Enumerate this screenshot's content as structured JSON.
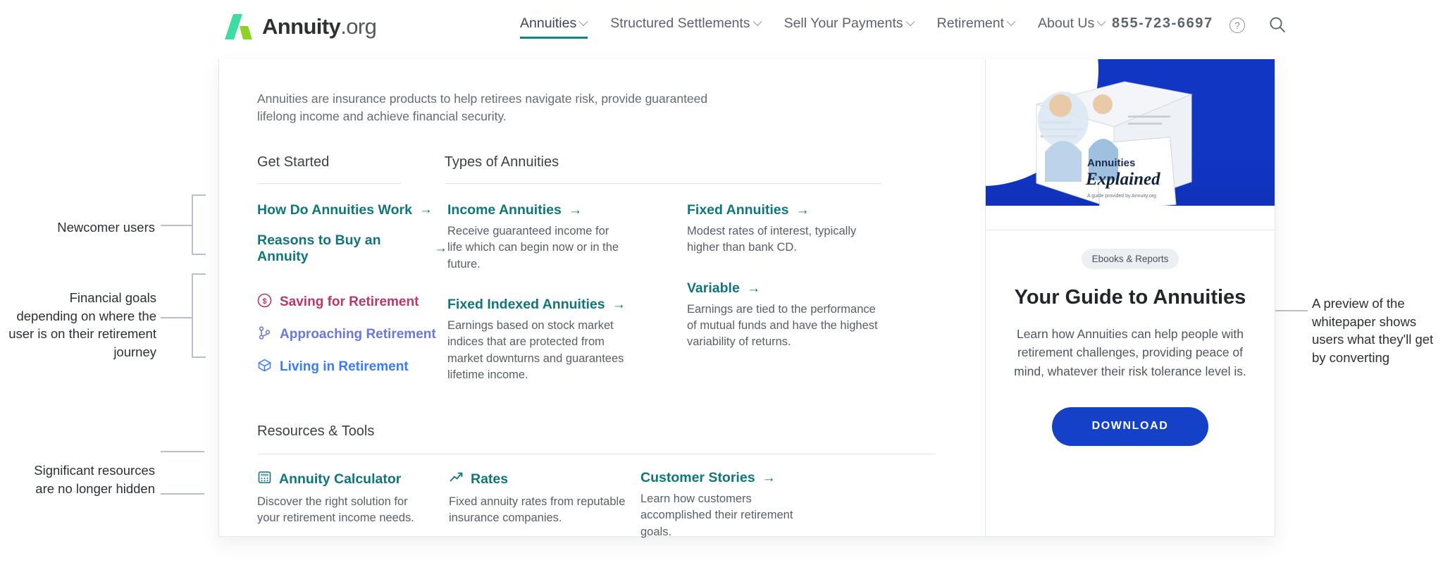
{
  "brand": {
    "name": "Annuity",
    "suffix": ".org"
  },
  "nav": {
    "items": [
      {
        "label": "Annuities",
        "caret": true,
        "active": true
      },
      {
        "label": "Structured Settlements",
        "caret": true,
        "active": false
      },
      {
        "label": "Sell Your Payments",
        "caret": true,
        "active": false
      },
      {
        "label": "Retirement",
        "caret": true,
        "active": false
      },
      {
        "label": "About Us",
        "caret": true,
        "active": false
      }
    ],
    "phone": "855-723-6697",
    "help_icon": "question-circle-icon",
    "search_icon": "search-icon"
  },
  "menu": {
    "intro": "Annuities are insurance products to help retirees navigate risk, provide guaranteed lifelong income and achieve financial security.",
    "headings": {
      "get_started": "Get Started",
      "types": "Types of Annuities",
      "resources": "Resources & Tools"
    },
    "get_started_links": [
      {
        "label": "How Do Annuities Work",
        "arrow": "→"
      },
      {
        "label": "Reasons to Buy an Annuity",
        "arrow": "→"
      }
    ],
    "journey_links": [
      {
        "label": "Saving for Retirement",
        "icon": "dollar-circle-icon",
        "color": "#b8386a"
      },
      {
        "label": "Approaching Retirement",
        "icon": "branch-icon",
        "color": "#6c78d6"
      },
      {
        "label": "Living in Retirement",
        "icon": "cube-icon",
        "color": "#3b7bf5"
      }
    ],
    "types": [
      {
        "title": "Income Annuities",
        "arrow": "→",
        "desc": "Receive guaranteed income for life which can begin now or in the future.",
        "col": 1
      },
      {
        "title": "Fixed Annuities",
        "arrow": "→",
        "desc": "Modest rates of interest, typically higher than bank CD.",
        "col": 2
      },
      {
        "title": "Fixed Indexed Annuities",
        "arrow": "→",
        "desc": "Earnings based on stock market indices that are protected from market downturns and guarantees lifetime income.",
        "col": 1
      },
      {
        "title": "Variable",
        "arrow": "→",
        "desc": "Earnings are tied to the performance of mutual funds and have the highest variability of returns.",
        "col": 2
      }
    ],
    "resources": [
      {
        "title": "Annuity Calculator",
        "icon": "calculator-icon",
        "arrow": "",
        "desc": "Discover the right solution for your retirement income needs."
      },
      {
        "title": "Rates",
        "icon": "trend-up-icon",
        "arrow": "",
        "desc": "Fixed annuity rates from reputable insurance companies."
      },
      {
        "title": "Customer Stories",
        "icon": "",
        "arrow": "→",
        "desc": "Learn how customers accomplished their retirement goals."
      }
    ]
  },
  "promo": {
    "badge": "Ebooks & Reports",
    "title": "Your Guide to Annuities",
    "desc": "Learn how Annuities can help people with retirement challenges, providing peace of mind, whatever their risk tolerance level is.",
    "button": "DOWNLOAD",
    "cover_title": "Annuities",
    "cover_subtitle": "Explained",
    "cover_footnote": "A guide provided by Annuity.org"
  },
  "annotations": [
    {
      "text": "Newcomer users"
    },
    {
      "text": "Financial goals depending on where the user is on their retirement journey"
    },
    {
      "text": "Significant resources are no longer hidden"
    },
    {
      "text": "A preview of the whitepaper shows users what they'll get by converting"
    }
  ],
  "colors": {
    "teal": "#11757c",
    "nav_underline": "#12848c",
    "promo_blue": "#1441c8",
    "logo_green": "#3ddcA0",
    "logo_lime": "#8cd322"
  }
}
